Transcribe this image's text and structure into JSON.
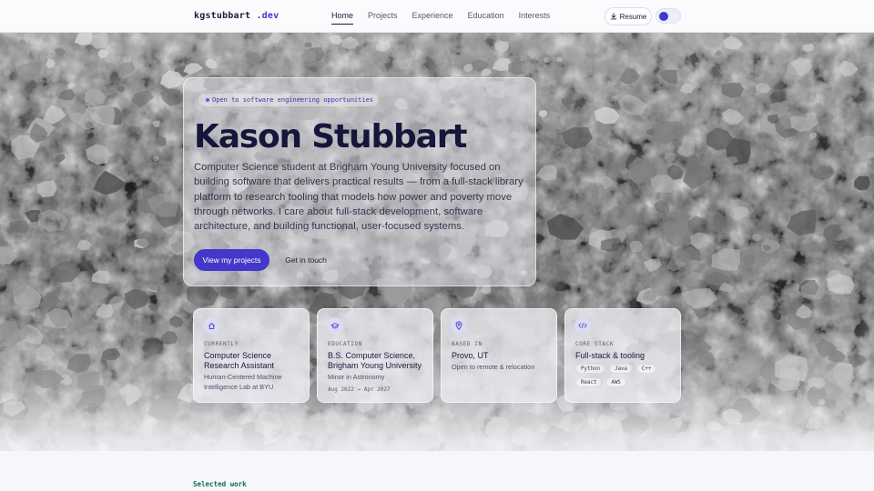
{
  "nav": {
    "logo_main": "kgstubbart",
    "logo_accent": ".dev",
    "links": [
      {
        "label": "Home",
        "active": true
      },
      {
        "label": "Projects",
        "active": false
      },
      {
        "label": "Experience",
        "active": false
      },
      {
        "label": "Education",
        "active": false
      },
      {
        "label": "Interests",
        "active": false
      }
    ],
    "resume_label": "Resume",
    "accent_color": "#4338ca"
  },
  "hero": {
    "badge": "Open to software engineering opportunities",
    "name": "Kason Stubbart",
    "description": "Computer Science student at Brigham Young University focused on building software that delivers practical results — from a full-stack library platform to research tooling that models how power and poverty move through networks. I care about full-stack development, software architecture, and building functional, user-focused systems.",
    "primary_button": "View my projects",
    "secondary_button": "Get in touch"
  },
  "cards": [
    {
      "icon": "home-icon",
      "label": "CURRENTLY",
      "title": "Computer Science Research Assistant",
      "sub": "Human-Centered Machine Intelligence Lab at BYU"
    },
    {
      "icon": "graduation-cap-icon",
      "label": "EDUCATION",
      "title": "B.S. Computer Science, Brigham Young University",
      "sub": "Minor in Astronomy",
      "date": "Aug 2022 → Apr 2027"
    },
    {
      "icon": "location-pin-icon",
      "label": "BASED IN",
      "title": "Provo, UT",
      "sub": "Open to remote & relocation"
    },
    {
      "icon": "code-icon",
      "label": "CORE STACK",
      "title": "Full-stack & tooling",
      "chips": [
        "Python",
        "Java",
        "C++",
        "React",
        "AWS"
      ]
    }
  ],
  "section": {
    "label": "Selected work"
  }
}
